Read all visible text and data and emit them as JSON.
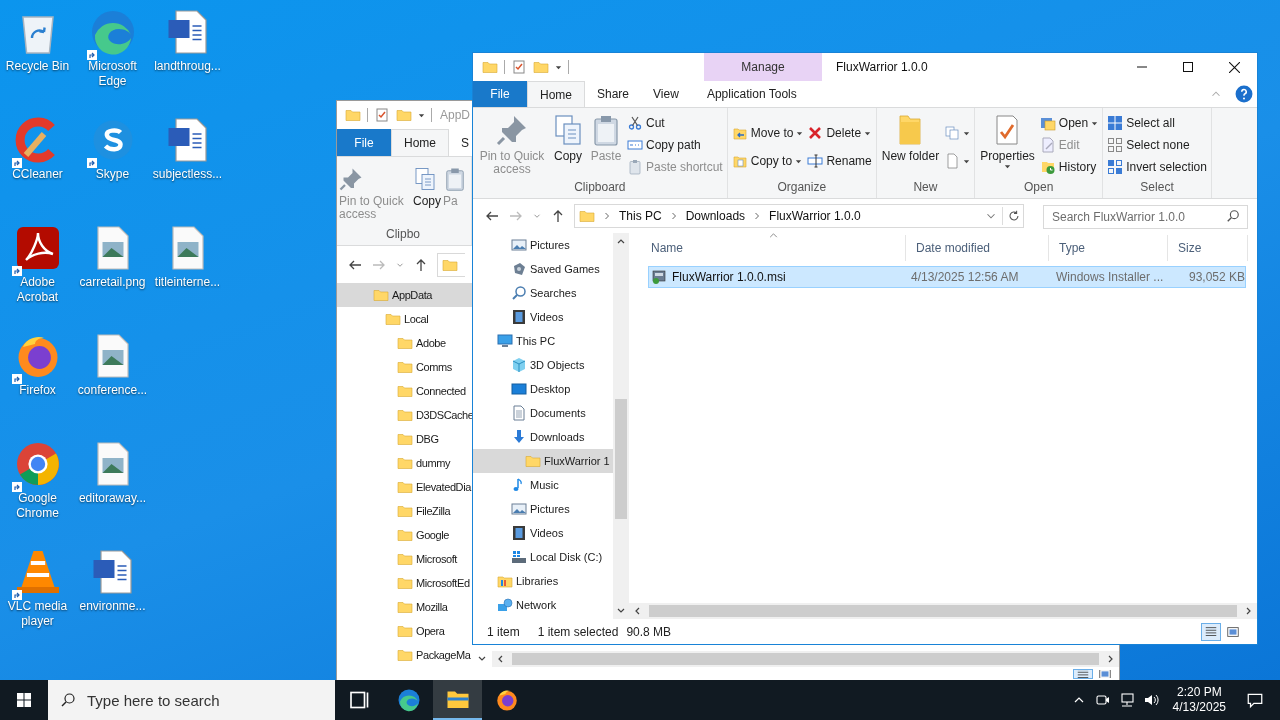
{
  "desktop": {
    "columns": [
      [
        {
          "label": "Recycle Bin",
          "kind": "recycle",
          "shortcut": false
        },
        {
          "label": "CCleaner",
          "kind": "ccleaner",
          "shortcut": true
        },
        {
          "label": "Adobe Acrobat",
          "kind": "acrobat",
          "shortcut": true
        },
        {
          "label": "Firefox",
          "kind": "firefox",
          "shortcut": true
        },
        {
          "label": "Google Chrome",
          "kind": "chrome",
          "shortcut": true
        },
        {
          "label": "VLC media player",
          "kind": "vlc",
          "shortcut": true
        }
      ],
      [
        {
          "label": "Microsoft Edge",
          "kind": "edge",
          "shortcut": true
        },
        {
          "label": "Skype",
          "kind": "skype",
          "shortcut": true
        },
        {
          "label": "carretail.png",
          "kind": "image",
          "shortcut": false
        },
        {
          "label": "conference...",
          "kind": "image",
          "shortcut": false
        },
        {
          "label": "editoraway...",
          "kind": "image",
          "shortcut": false
        },
        {
          "label": "environme...",
          "kind": "word",
          "shortcut": false
        }
      ],
      [
        {
          "label": "landthroug...",
          "kind": "word",
          "shortcut": false
        },
        {
          "label": "subjectless...",
          "kind": "word",
          "shortcut": false
        },
        {
          "label": "titleinterne...",
          "kind": "image",
          "shortcut": false
        }
      ]
    ]
  },
  "back_window": {
    "title": "AppD",
    "tabs": [
      {
        "label": "File",
        "kind": "file",
        "selected": false
      },
      {
        "label": "Home",
        "kind": "tab",
        "selected": true
      },
      {
        "label": "S",
        "kind": "tab",
        "selected": false
      }
    ],
    "ribbon": [
      {
        "label": "Clipbo",
        "columns": [
          [
            {
              "label": "Pin to Quick access",
              "kind": "pin",
              "disabled": true,
              "dropdown": false
            }
          ],
          [
            {
              "label": "Copy",
              "kind": "copy",
              "disabled": false,
              "dropdown": false
            }
          ],
          [
            {
              "label": "Pa",
              "kind": "paste",
              "disabled": true,
              "dropdown": false
            }
          ]
        ]
      }
    ],
    "tree": [
      {
        "label": "AppData",
        "selected": true,
        "children": [
          {
            "label": "Local",
            "selected": false,
            "children": [
              {
                "label": "Adobe",
                "selected": false
              },
              {
                "label": "Comms",
                "selected": false
              },
              {
                "label": "Connected",
                "selected": false
              },
              {
                "label": "D3DSCache",
                "selected": false
              },
              {
                "label": "DBG",
                "selected": false
              },
              {
                "label": "dummy",
                "selected": false
              },
              {
                "label": "ElevatedDia",
                "selected": false
              },
              {
                "label": "FileZilla",
                "selected": false
              },
              {
                "label": "Google",
                "selected": false
              },
              {
                "label": "Microsoft",
                "selected": false
              },
              {
                "label": "MicrosoftEd",
                "selected": false
              },
              {
                "label": "Mozilla",
                "selected": false
              },
              {
                "label": "Opera",
                "selected": false
              },
              {
                "label": "PackageMa",
                "selected": false
              }
            ]
          }
        ]
      }
    ],
    "view_buttons": [
      {
        "kind": "details",
        "selected": true
      },
      {
        "kind": "large_icons",
        "selected": false
      }
    ]
  },
  "front_window": {
    "title": "FluxWarrior 1.0.0",
    "context_group": "Manage",
    "tabs": [
      {
        "label": "File",
        "kind": "file",
        "selected": false
      },
      {
        "label": "Home",
        "kind": "tab",
        "selected": true
      },
      {
        "label": "Share",
        "kind": "tab",
        "selected": false
      },
      {
        "label": "View",
        "kind": "tab",
        "selected": false
      },
      {
        "label": "Application Tools",
        "kind": "context",
        "selected": false
      }
    ],
    "ribbon": [
      {
        "label": "Clipboard",
        "columns": [
          [
            {
              "label": "Pin to Quick access",
              "kind": "pin",
              "disabled": true,
              "dropdown": false
            }
          ],
          [
            {
              "label": "Copy",
              "kind": "copy",
              "disabled": false,
              "dropdown": false
            }
          ],
          [
            {
              "label": "Paste",
              "kind": "paste",
              "disabled": true,
              "dropdown": false
            }
          ],
          [
            {
              "label": "Cut",
              "kind": "cut",
              "disabled": false,
              "dropdown": false
            },
            {
              "label": "Copy path",
              "kind": "copypath",
              "disabled": false,
              "dropdown": false
            },
            {
              "label": "Paste shortcut",
              "kind": "pasteshortcut",
              "disabled": true,
              "dropdown": false
            }
          ]
        ]
      },
      {
        "label": "Organize",
        "columns": [
          [
            {
              "label": "Move to",
              "kind": "moveto",
              "dropdown": true,
              "disabled": false
            },
            {
              "label": "Copy to",
              "kind": "copyto",
              "dropdown": true,
              "disabled": false
            }
          ],
          [
            {
              "label": "Delete",
              "kind": "delete",
              "dropdown": true,
              "disabled": false
            },
            {
              "label": "Rename",
              "kind": "rename",
              "disabled": false,
              "dropdown": false
            }
          ]
        ]
      },
      {
        "label": "New",
        "columns": [
          [
            {
              "label": "New folder",
              "kind": "newfolder",
              "disabled": false,
              "dropdown": false
            }
          ],
          [
            {
              "kind": "newitem",
              "dropdown": true,
              "disabled": false
            },
            {
              "kind": "easyaccess",
              "dropdown": true,
              "disabled": false
            }
          ]
        ]
      },
      {
        "label": "Open",
        "columns": [
          [
            {
              "label": "Properties",
              "kind": "properties",
              "dropdown": true,
              "disabled": false
            }
          ],
          [
            {
              "label": "Open",
              "kind": "open",
              "dropdown": true,
              "disabled": false
            },
            {
              "label": "Edit",
              "kind": "edit",
              "disabled": true,
              "dropdown": false
            },
            {
              "label": "History",
              "kind": "history",
              "disabled": false,
              "dropdown": false
            }
          ]
        ]
      },
      {
        "label": "Select",
        "columns": [
          [
            {
              "label": "Select all",
              "kind": "selectall",
              "disabled": false,
              "dropdown": false
            },
            {
              "label": "Select none",
              "kind": "selectnone",
              "disabled": false,
              "dropdown": false
            },
            {
              "label": "Invert selection",
              "kind": "invert",
              "disabled": false,
              "dropdown": false
            }
          ]
        ]
      }
    ],
    "path": [
      "This PC",
      "Downloads",
      "FluxWarrior 1.0.0"
    ],
    "search_placeholder": "Search FluxWarrior 1.0.0",
    "nav": [
      {
        "children": [
          {
            "label": "Pictures",
            "kind": "pictures",
            "selected": false
          },
          {
            "label": "Saved Games",
            "kind": "savedgames",
            "selected": false
          },
          {
            "label": "Searches",
            "kind": "searches",
            "selected": false
          },
          {
            "label": "Videos",
            "kind": "videos",
            "selected": false
          }
        ]
      },
      {
        "label": "This PC",
        "kind": "thispc",
        "selected": false,
        "children": [
          {
            "label": "3D Objects",
            "kind": "objects3d",
            "selected": false
          },
          {
            "label": "Desktop",
            "kind": "desktop",
            "selected": false
          },
          {
            "label": "Documents",
            "kind": "documents",
            "selected": false
          },
          {
            "label": "Downloads",
            "kind": "downloads",
            "selected": false,
            "children": [
              {
                "label": "FluxWarrior 1",
                "selected": true
              }
            ]
          },
          {
            "label": "Music",
            "kind": "music",
            "selected": false
          },
          {
            "label": "Pictures",
            "kind": "pictures",
            "selected": false
          },
          {
            "label": "Videos",
            "kind": "videos",
            "selected": false
          },
          {
            "label": "Local Disk (C:)",
            "kind": "localdisk",
            "selected": false
          }
        ]
      },
      {
        "label": "Libraries",
        "kind": "libraries",
        "selected": false
      },
      {
        "label": "Network",
        "kind": "network",
        "selected": false
      }
    ],
    "columns": [
      {
        "label": "Name",
        "sorted": true
      },
      {
        "label": "Date modified",
        "sorted": false
      },
      {
        "label": "Type",
        "sorted": false
      },
      {
        "label": "Size",
        "sorted": false
      }
    ],
    "rows": [
      {
        "name": "FluxWarrior 1.0.0.msi",
        "date": "4/13/2025 12:56 AM",
        "type": "Windows Installer ...",
        "size": "93,052 KB",
        "selected": true
      }
    ],
    "status": {
      "count": "1 item",
      "selection": "1 item selected",
      "size": "90.8 MB"
    },
    "view_buttons": [
      {
        "kind": "details",
        "selected": true
      },
      {
        "kind": "large_icons",
        "selected": false
      }
    ]
  },
  "taskbar": {
    "search_placeholder": "Type here to search",
    "apps": [
      {
        "kind": "taskview",
        "active": false
      },
      {
        "kind": "edge",
        "active": false
      },
      {
        "kind": "explorer",
        "active": true
      },
      {
        "kind": "firefox",
        "active": false
      }
    ],
    "time": "2:20 PM",
    "date": "4/13/2025"
  }
}
